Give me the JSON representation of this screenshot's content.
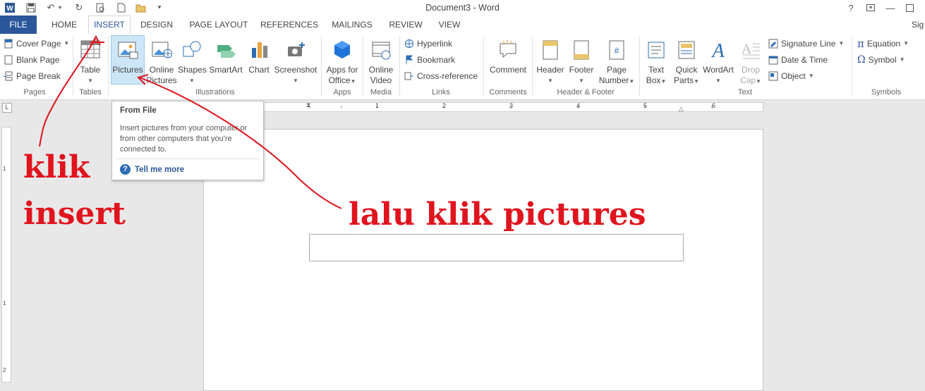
{
  "title_bar": {
    "title": "Document3 - Word",
    "help": "?"
  },
  "tabs": [
    {
      "label": "FILE"
    },
    {
      "label": "HOME"
    },
    {
      "label": "INSERT"
    },
    {
      "label": "DESIGN"
    },
    {
      "label": "PAGE LAYOUT"
    },
    {
      "label": "REFERENCES"
    },
    {
      "label": "MAILINGS"
    },
    {
      "label": "REVIEW"
    },
    {
      "label": "VIEW"
    }
  ],
  "account": "Sig",
  "ribbon": {
    "pages": {
      "label": "Pages",
      "cover_page": "Cover Page",
      "blank_page": "Blank Page",
      "page_break": "Page Break"
    },
    "tables": {
      "label": "Tables",
      "table": "Table"
    },
    "illustrations": {
      "label": "Illustrations",
      "pictures": "Pictures",
      "online_pictures_1": "Online",
      "online_pictures_2": "Pictures",
      "shapes": "Shapes",
      "smartart": "SmartArt",
      "chart": "Chart",
      "screenshot": "Screenshot"
    },
    "apps": {
      "label": "Apps",
      "apps_for_office_1": "Apps for",
      "apps_for_office_2": "Office"
    },
    "media": {
      "label": "Media",
      "online_video_1": "Online",
      "online_video_2": "Video"
    },
    "links": {
      "label": "Links",
      "hyperlink": "Hyperlink",
      "bookmark": "Bookmark",
      "cross_reference": "Cross-reference"
    },
    "comments": {
      "label": "Comments",
      "comment": "Comment"
    },
    "header_footer": {
      "label": "Header & Footer",
      "header": "Header",
      "footer": "Footer",
      "page_number_1": "Page",
      "page_number_2": "Number"
    },
    "text": {
      "label": "Text",
      "text_box_1": "Text",
      "text_box_2": "Box",
      "quick_parts_1": "Quick",
      "quick_parts_2": "Parts",
      "wordart": "WordArt",
      "drop_cap_1": "Drop",
      "drop_cap_2": "Cap",
      "signature_line": "Signature Line",
      "date_time": "Date & Time",
      "object": "Object"
    },
    "symbols": {
      "label": "Symbols",
      "equation": "Equation",
      "symbol": "Symbol"
    }
  },
  "tooltip": {
    "title": "From File",
    "body": "Insert pictures from your computer or from other computers that you're connected to.",
    "tell_me_more": "Tell me more"
  },
  "ruler": {
    "h_numbers": [
      "1",
      "2",
      "3",
      "4",
      "5",
      "6"
    ],
    "v_numbers": [
      "1",
      "1",
      "2"
    ]
  },
  "annotations": {
    "left_line1": "klik",
    "left_line2": "insert",
    "right": "lalu klik pictures"
  },
  "colors": {
    "accent": "#2b579a",
    "annotation": "#e0141e"
  }
}
